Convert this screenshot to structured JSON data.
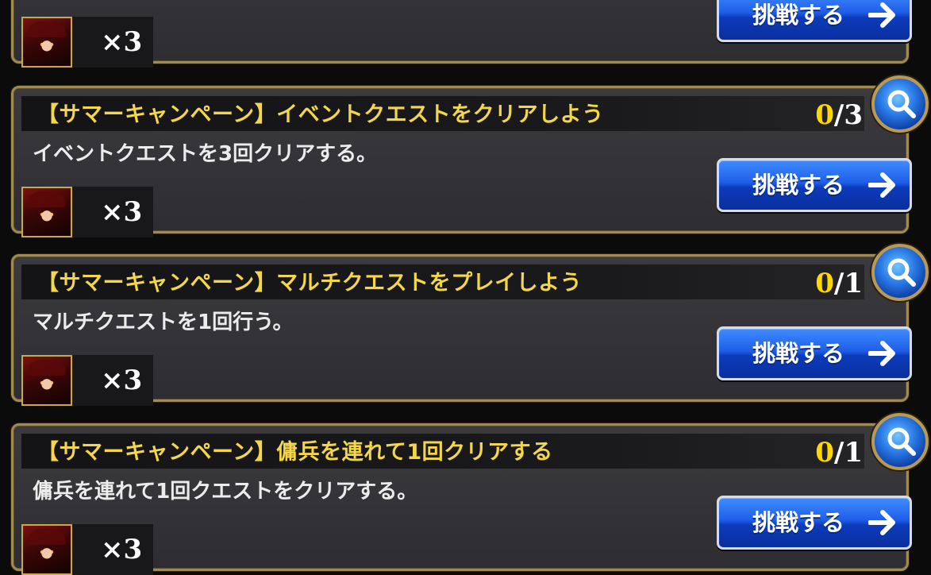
{
  "missions": [
    {
      "reward": {
        "count": "×3"
      },
      "button": {
        "label": "挑戦する"
      }
    },
    {
      "title": "【サマーキャンペーン】イベントクエストをクリアしよう",
      "progress": {
        "current": "0",
        "total": "/3"
      },
      "description": "イベントクエストを3回クリアする。",
      "reward": {
        "count": "×3"
      },
      "button": {
        "label": "挑戦する"
      }
    },
    {
      "title": "【サマーキャンペーン】マルチクエストをプレイしよう",
      "progress": {
        "current": "0",
        "total": "/1"
      },
      "description": "マルチクエストを1回行う。",
      "reward": {
        "count": "×3"
      },
      "button": {
        "label": "挑戦する"
      }
    },
    {
      "title": "【サマーキャンペーン】傭兵を連れて1回クリアする",
      "progress": {
        "current": "0",
        "total": "/1"
      },
      "description": "傭兵を連れて1回クエストをクリアする。",
      "reward": {
        "count": "×3"
      },
      "button": {
        "label": "挑戦する"
      }
    }
  ],
  "icons": {
    "search": "magnifier-icon",
    "arrow": "arrow-right-icon",
    "reward": "character-portrait"
  },
  "colors": {
    "title": "#f4d64a",
    "progress_current": "#ffd800",
    "button_blue": "#1f5ee8",
    "frame_gold": "#a08a52"
  }
}
